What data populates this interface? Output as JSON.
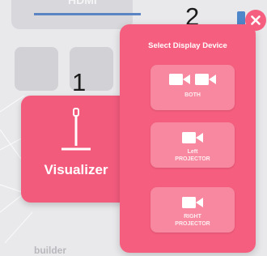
{
  "background": {
    "input_label": "HDMI",
    "footer_text": "builder"
  },
  "markers": {
    "one": "1",
    "two": "2"
  },
  "visualizer": {
    "label": "Visualizer",
    "icon": "visualizer-icon"
  },
  "display_panel": {
    "title": "Select Display Device",
    "close_icon": "close-icon",
    "options": [
      {
        "label": "BOTH",
        "icon": "camera-icon",
        "icon_count": 2
      },
      {
        "label_line1": "Left",
        "label_line2": "PROJECTOR",
        "icon": "camera-icon",
        "icon_count": 1
      },
      {
        "label_line1": "RIGHT",
        "label_line2": "PROJECTOR",
        "icon": "camera-icon",
        "icon_count": 1
      }
    ]
  },
  "colors": {
    "panel": "#f55e7e",
    "option": "#f7889f",
    "visualizer": "#f35b7d",
    "accent_blue": "#5b84c2"
  }
}
